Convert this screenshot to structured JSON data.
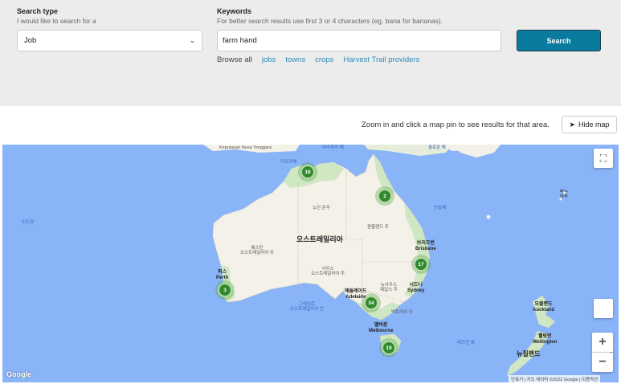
{
  "search": {
    "type_label": "Search type",
    "type_help": "I would like to search for a",
    "type_value": "Job",
    "keywords_label": "Keywords",
    "keywords_help": "For better search results use first 3 or 4 characters (eg. bana for bananas).",
    "keywords_value": "farm hand",
    "search_button": "Search",
    "browse_label": "Browse all",
    "browse_links": [
      "jobs",
      "towns",
      "crops",
      "Harvest Trail providers"
    ]
  },
  "map_header": {
    "hint": "Zoom in and click a map pin to see results for that area.",
    "hide_map_label": "Hide map"
  },
  "map": {
    "country_label": "오스트레일리아",
    "labels": {
      "kepulauan": "Kepulauan Nusa Tenggara",
      "arafura": "아라푸라 해",
      "solomon": "솔로몬 해",
      "coral": "산호해",
      "indian_ocean": "인도양",
      "timor": "티모르해",
      "nt": "노던 준주",
      "qld": "퀸즐랜드 주",
      "wa": "웨스턴\n오스트레일리아 주",
      "sa": "사우스\n오스트레일리아 주",
      "nsw": "뉴사우스\n웨일스 주",
      "vic": "빅토리아 주",
      "gab": "그레이트\n오스트레일리아 만",
      "tasman": "태즈먼 해",
      "nz": "뉴질랜드",
      "vanuatu": "바누\n아투",
      "perth": "퍼스\nPerth",
      "adelaide": "애들레이드\nAdelaide",
      "melbourne": "멜버른\nMelbourne",
      "sydney": "시드니\nSydney",
      "brisbane": "브리즈번\nBrisbane",
      "auckland": "오클랜드\nAuckland",
      "wellington": "웰링턴\nWellington"
    },
    "clusters": [
      {
        "id": "darwin",
        "count": "16"
      },
      {
        "id": "cairns",
        "count": "2"
      },
      {
        "id": "brisbane",
        "count": "17"
      },
      {
        "id": "perth",
        "count": "3"
      },
      {
        "id": "adelaide",
        "count": "34"
      },
      {
        "id": "tasmania",
        "count": "19"
      }
    ],
    "attribution": "단축키  |  지도 데이터 ©2022 Google  |  이용약관",
    "google": "Google",
    "colors": {
      "water": "#8ab4f8",
      "land": "#f4f1e8",
      "green": "#cfe7c2",
      "cluster": "#2f8a2e"
    }
  }
}
